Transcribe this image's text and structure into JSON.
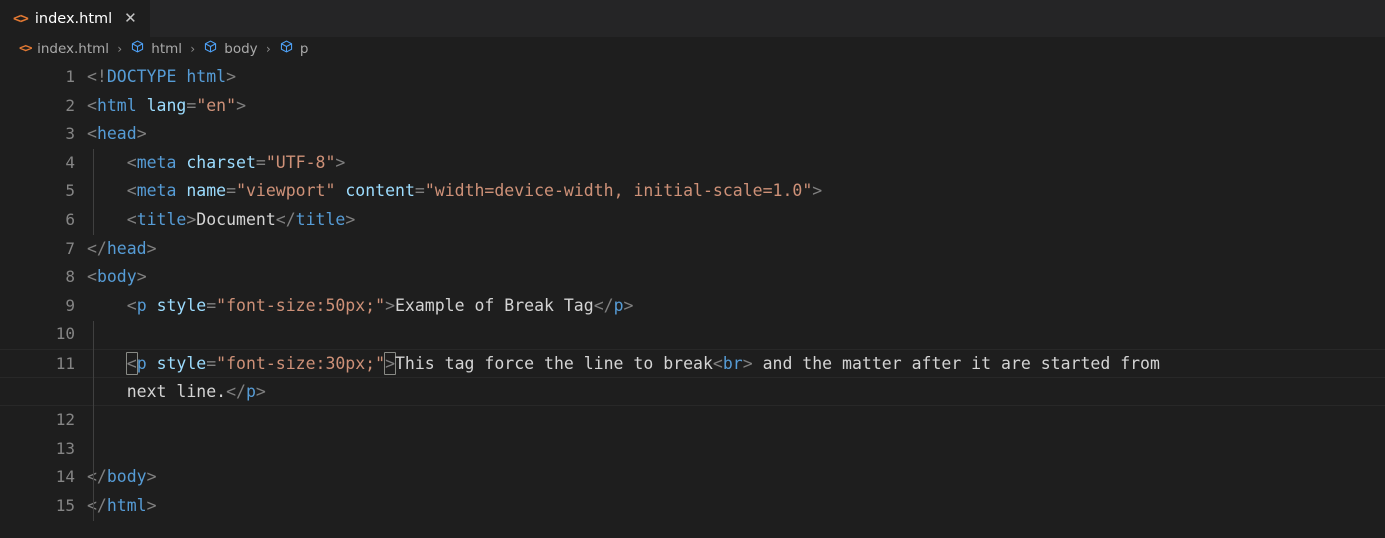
{
  "window": {
    "app": "visual-studio-code",
    "colors": {
      "editor_bg": "#1e1e1e",
      "tabbar_bg": "#252526",
      "tag": "#569cd6",
      "attribute": "#9cdcfe",
      "string": "#ce9178",
      "punctuation": "#808080",
      "text": "#d4d4d4",
      "line_number": "#858585",
      "file_icon": "#e37933",
      "breadcrumb_text": "#a9a9a9"
    }
  },
  "tabs": [
    {
      "label": "index.html",
      "icon": "html-file-icon",
      "icon_glyph": "<>",
      "close_glyph": "✕",
      "active": true
    }
  ],
  "breadcrumb": {
    "separator": "›",
    "items": [
      {
        "label": "index.html",
        "icon": "html-file-icon",
        "icon_glyph": "<>"
      },
      {
        "label": "html",
        "icon": "symbol-field-icon"
      },
      {
        "label": "body",
        "icon": "symbol-field-icon"
      },
      {
        "label": "p",
        "icon": "symbol-field-icon"
      }
    ]
  },
  "editor": {
    "language": "html",
    "cursor_line": 11,
    "bracket_match_line": 11,
    "lines": [
      {
        "num": "1",
        "indent": 0
      },
      {
        "num": "2",
        "indent": 0
      },
      {
        "num": "3",
        "indent": 0
      },
      {
        "num": "4",
        "indent": 1
      },
      {
        "num": "5",
        "indent": 1
      },
      {
        "num": "6",
        "indent": 1
      },
      {
        "num": "7",
        "indent": 0
      },
      {
        "num": "8",
        "indent": 0
      },
      {
        "num": "9",
        "indent": 1
      },
      {
        "num": "10",
        "indent": 0
      },
      {
        "num": "11",
        "indent": 1
      },
      {
        "num": "",
        "indent": 1,
        "wrapped": true
      },
      {
        "num": "12",
        "indent": 1
      },
      {
        "num": "13",
        "indent": 1
      },
      {
        "num": "14",
        "indent": 0
      },
      {
        "num": "15",
        "indent": 0
      }
    ],
    "code": {
      "l1_lt": "<!",
      "l1_doctype": "DOCTYPE",
      "l1_space": " ",
      "l1_html": "html",
      "l1_gt": ">",
      "l2_lt": "<",
      "l2_tag": "html",
      "l2_sp": " ",
      "l2_attr": "lang",
      "l2_eq": "=",
      "l2_val": "\"en\"",
      "l2_gt": ">",
      "l3_lt": "<",
      "l3_tag": "head",
      "l3_gt": ">",
      "l4_indent": "    ",
      "l4_lt": "<",
      "l4_tag": "meta",
      "l4_sp": " ",
      "l4_attr": "charset",
      "l4_eq": "=",
      "l4_val": "\"UTF-8\"",
      "l4_gt": ">",
      "l5_indent": "    ",
      "l5_lt": "<",
      "l5_tag": "meta",
      "l5_sp": " ",
      "l5_attr1": "name",
      "l5_eq1": "=",
      "l5_val1": "\"viewport\"",
      "l5_sp2": " ",
      "l5_attr2": "content",
      "l5_eq2": "=",
      "l5_val2": "\"width=device-width, initial-scale=1.0\"",
      "l5_gt": ">",
      "l6_indent": "    ",
      "l6_lt": "<",
      "l6_tag": "title",
      "l6_gt": ">",
      "l6_text": "Document",
      "l6_lt2": "</",
      "l6_tag2": "title",
      "l6_gt2": ">",
      "l7_lt": "</",
      "l7_tag": "head",
      "l7_gt": ">",
      "l8_lt": "<",
      "l8_tag": "body",
      "l8_gt": ">",
      "l9_indent": "    ",
      "l9_lt": "<",
      "l9_tag": "p",
      "l9_sp": " ",
      "l9_attr": "style",
      "l9_eq": "=",
      "l9_val": "\"font-size:50px;\"",
      "l9_gt": ">",
      "l9_text": "Example of Break Tag",
      "l9_lt2": "</",
      "l9_tag2": "p",
      "l9_gt2": ">",
      "l10_text": "",
      "l11_indent": "    ",
      "l11_lt": "<",
      "l11_tag": "p",
      "l11_sp": " ",
      "l11_attr": "style",
      "l11_eq": "=",
      "l11_val": "\"font-size:30px;\"",
      "l11_gt": ">",
      "l11_text1": "This tag force the line to break",
      "l11_br_lt": "<",
      "l11_br_tag": "br",
      "l11_br_gt": ">",
      "l11_text2": " and the matter after it are started from",
      "l11w_indent": "    ",
      "l11w_text": "next line.",
      "l11w_lt": "</",
      "l11w_tag": "p",
      "l11w_gt": ">",
      "l12_text": "",
      "l13_text": "",
      "l14_lt": "</",
      "l14_tag": "body",
      "l14_gt": ">",
      "l15_lt": "</",
      "l15_tag": "html",
      "l15_gt": ">"
    }
  }
}
